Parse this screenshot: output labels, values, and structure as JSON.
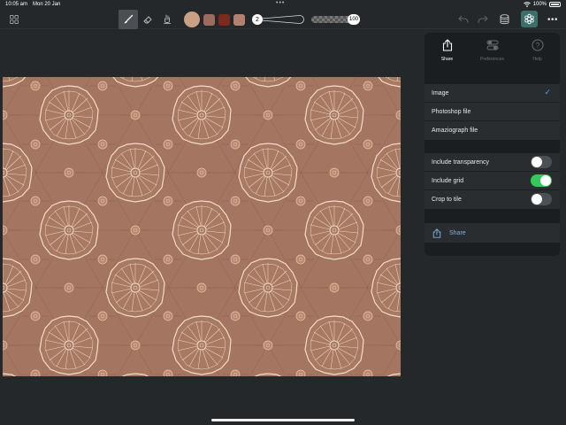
{
  "status_bar": {
    "time": "10:05 am",
    "date": "Mon 20 Jan",
    "battery": "100%",
    "battery_level": 1.0
  },
  "toolbar": {
    "icons": [
      "grid-icon",
      "brush-icon",
      "eraser-icon",
      "smudge-icon",
      "undo-icon",
      "redo-icon",
      "layers-icon",
      "symmetry-icon",
      "more-icon"
    ],
    "active_tool": "brush",
    "primary_color": "#c9a084",
    "recent_colors": [
      "#9c6b5d",
      "#7a2c1c",
      "#b48070"
    ],
    "brush_size": "2",
    "opacity": "100"
  },
  "popover": {
    "tabs": [
      {
        "label": "Share",
        "icon": "share-icon",
        "active": true
      },
      {
        "label": "Preferences",
        "icon": "preferences-icon",
        "active": false
      },
      {
        "label": "Help",
        "icon": "help-icon",
        "active": false
      }
    ],
    "formats": [
      {
        "label": "Image",
        "selected": true
      },
      {
        "label": "Photoshop file",
        "selected": false
      },
      {
        "label": "Amaziograph file",
        "selected": false
      }
    ],
    "options": [
      {
        "label": "Include transparency",
        "on": false
      },
      {
        "label": "Include grid",
        "on": true
      },
      {
        "label": "Crop to tile",
        "on": false
      }
    ],
    "share_label": "Share"
  },
  "colors": {
    "background": "#24282b",
    "canvas": "#a47560",
    "pattern_line": "#f3dcc6",
    "accent_blue": "#5aa0e6",
    "toggle_on": "#34c85a"
  }
}
